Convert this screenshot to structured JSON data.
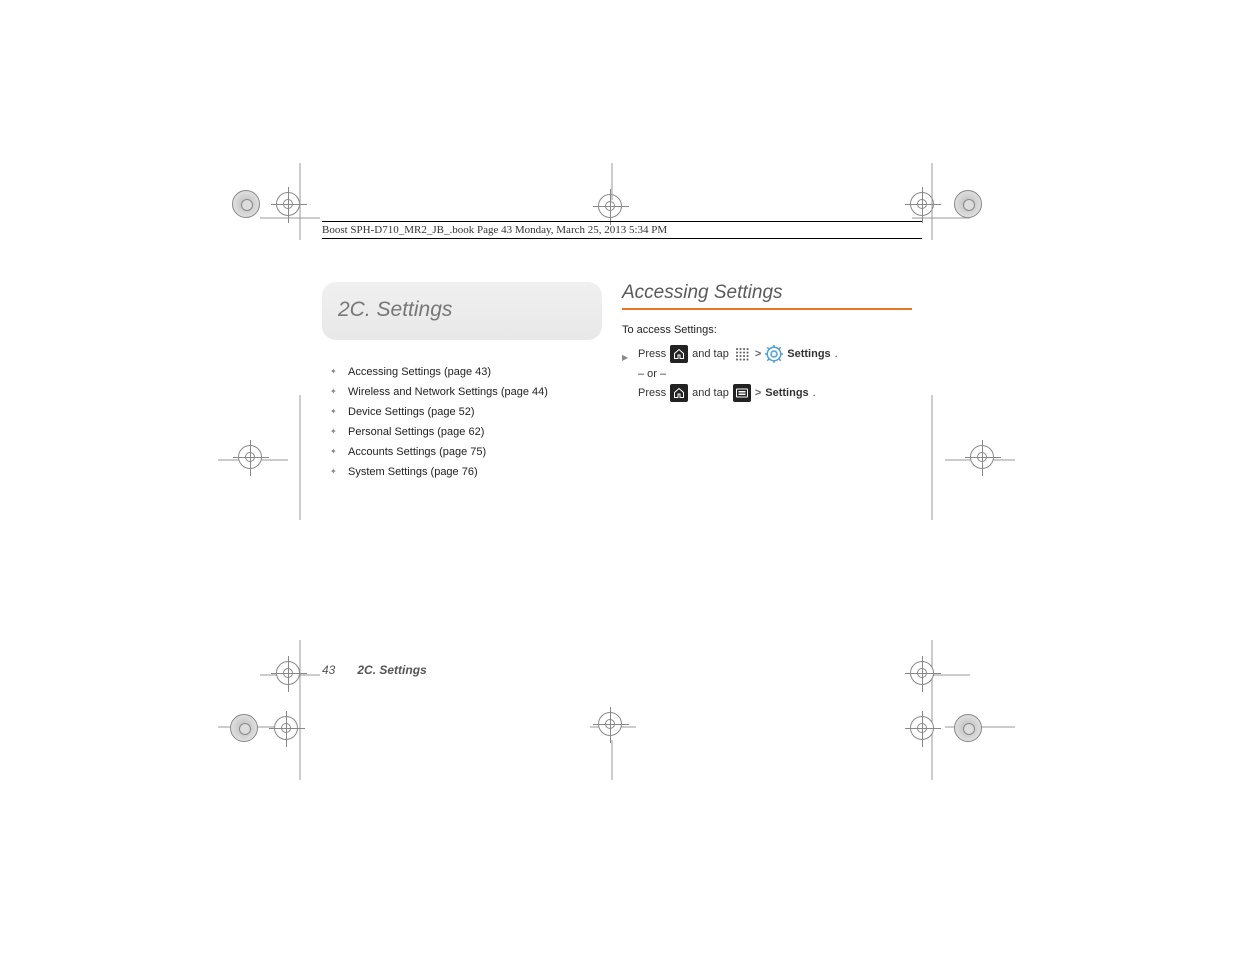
{
  "doc_header": "Boost SPH-D710_MR2_JB_.book  Page 43  Monday, March 25, 2013  5:34 PM",
  "chapter_title": "2C. Settings",
  "toc": [
    "Accessing Settings (page 43)",
    "Wireless and Network Settings (page 44)",
    "Device Settings (page 52)",
    "Personal Settings (page 62)",
    "Accounts Settings (page 75)",
    "System Settings (page 76)"
  ],
  "section_heading": "Accessing Settings",
  "intro_text": "To access Settings:",
  "step1": {
    "press": "Press",
    "and_tap": "and tap",
    "gt": ">",
    "settings": "Settings",
    "period": "."
  },
  "or_text": "– or –",
  "step2": {
    "press": "Press",
    "and_tap": "and tap",
    "gt": ">",
    "settings": "Settings",
    "period": "."
  },
  "footer": {
    "page": "43",
    "title": "2C. Settings"
  }
}
